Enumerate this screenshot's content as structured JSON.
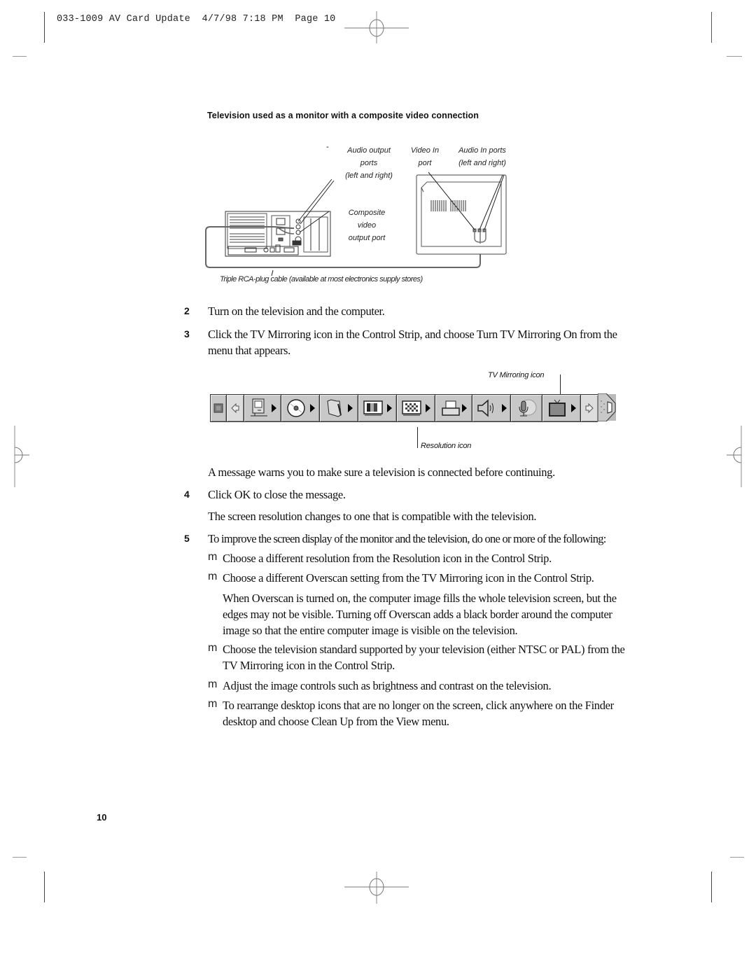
{
  "header": {
    "slug": "033-1009 AV Card Update  4/7/98 7:18 PM  Page 10"
  },
  "figure": {
    "caption": "Television used as a monitor with a composite video connection",
    "callouts": {
      "audio_output_ports": [
        "Audio output",
        "ports",
        "(left and right)"
      ],
      "video_in_port": [
        "Video In",
        "port"
      ],
      "audio_in_ports": [
        "Audio In ports",
        "(left and right)"
      ],
      "composite_video_output_port": [
        "Composite",
        "video",
        "output port"
      ],
      "tv_label": "TV",
      "cable": "Triple RCA-plug cable (available at most electronics supply stores)"
    }
  },
  "steps": [
    {
      "number": "2",
      "text": "Turn on the television and the computer."
    },
    {
      "number": "3",
      "text": "Click the TV Mirroring icon in the Control Strip, and choose Turn TV Mirroring On from the menu that appears."
    }
  ],
  "control_strip": {
    "tv_mirroring_label": "TV Mirroring icon",
    "resolution_label": "Resolution icon",
    "segments": [
      {
        "icon": "close-box-icon",
        "menu": false
      },
      {
        "icon": "collapse-arrow-icon",
        "menu": false
      },
      {
        "icon": "mac-monitor-icon",
        "menu": true
      },
      {
        "icon": "cd-icon",
        "menu": true
      },
      {
        "icon": "file-sharing-folder-icon",
        "menu": true
      },
      {
        "icon": "color-depth-icon",
        "menu": true
      },
      {
        "icon": "resolution-icon",
        "menu": true
      },
      {
        "icon": "printer-icon",
        "menu": true
      },
      {
        "icon": "speaker-volume-icon",
        "menu": true
      },
      {
        "icon": "sound-source-icon",
        "menu": false
      },
      {
        "icon": "tv-mirroring-icon",
        "menu": true
      },
      {
        "icon": "expand-arrow-icon",
        "menu": false
      },
      {
        "icon": "strip-tab-icon",
        "menu": false
      }
    ]
  },
  "after_strip": {
    "message_note": "A message warns you to make sure a television is connected before continuing.",
    "step4": {
      "number": "4",
      "text": "Click OK to close the message."
    },
    "resolution_note": "The screen resolution changes to one that is compatible with the television.",
    "step5": {
      "number": "5",
      "text": "To improve the screen display of the monitor and the television, do one or more of the following:"
    },
    "bullet_glyph": "m",
    "bullets": [
      {
        "text": "Choose a different resolution from the Resolution icon in the Control Strip."
      },
      {
        "text": "Choose a different Overscan setting from the TV Mirroring icon in the Control Strip."
      },
      {
        "text": "Choose the television standard supported by your television (either NTSC or PAL) from the TV Mirroring icon in the Control Strip."
      },
      {
        "text": "Adjust the image controls such as brightness and contrast on the television."
      },
      {
        "text": "To rearrange desktop icons that are no longer on the screen, click anywhere on the Finder desktop and choose Clean Up from the View menu."
      }
    ],
    "overscan_note": "When Overscan is turned on, the computer image fills the whole television screen, but the edges may not be visible. Turning off Overscan adds a black border around the computer image so that the entire computer image is visible on the television."
  },
  "footer": {
    "page_number": "10"
  }
}
